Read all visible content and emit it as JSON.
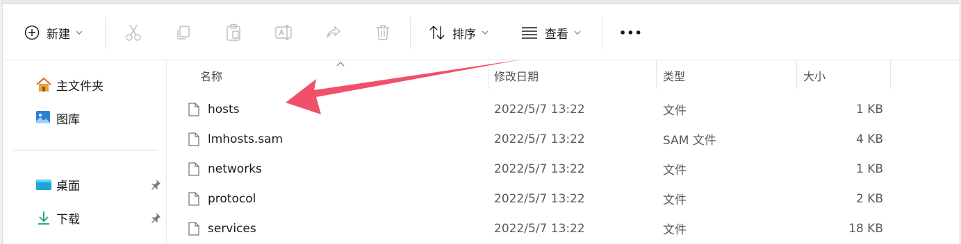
{
  "toolbar": {
    "new_label": "新建",
    "sort_label": "排序",
    "view_label": "查看",
    "more_label": "•••"
  },
  "nav": {
    "items": [
      {
        "label": "主文件夹",
        "icon": "home-icon"
      },
      {
        "label": "图库",
        "icon": "gallery-icon"
      }
    ],
    "pinned": [
      {
        "label": "桌面",
        "icon": "desktop-icon"
      },
      {
        "label": "下载",
        "icon": "download-icon"
      }
    ]
  },
  "columns": {
    "name": "名称",
    "date": "修改日期",
    "type": "类型",
    "size": "大小"
  },
  "files": [
    {
      "name": "hosts",
      "date": "2022/5/7 13:22",
      "type": "文件",
      "size": "1 KB"
    },
    {
      "name": "lmhosts.sam",
      "date": "2022/5/7 13:22",
      "type": "SAM 文件",
      "size": "4 KB"
    },
    {
      "name": "networks",
      "date": "2022/5/7 13:22",
      "type": "文件",
      "size": "1 KB"
    },
    {
      "name": "protocol",
      "date": "2022/5/7 13:22",
      "type": "文件",
      "size": "2 KB"
    },
    {
      "name": "services",
      "date": "2022/5/7 13:22",
      "type": "文件",
      "size": "18 KB"
    }
  ],
  "colors": {
    "annotation_arrow": "#f0506a",
    "accent": "#0067c0"
  }
}
